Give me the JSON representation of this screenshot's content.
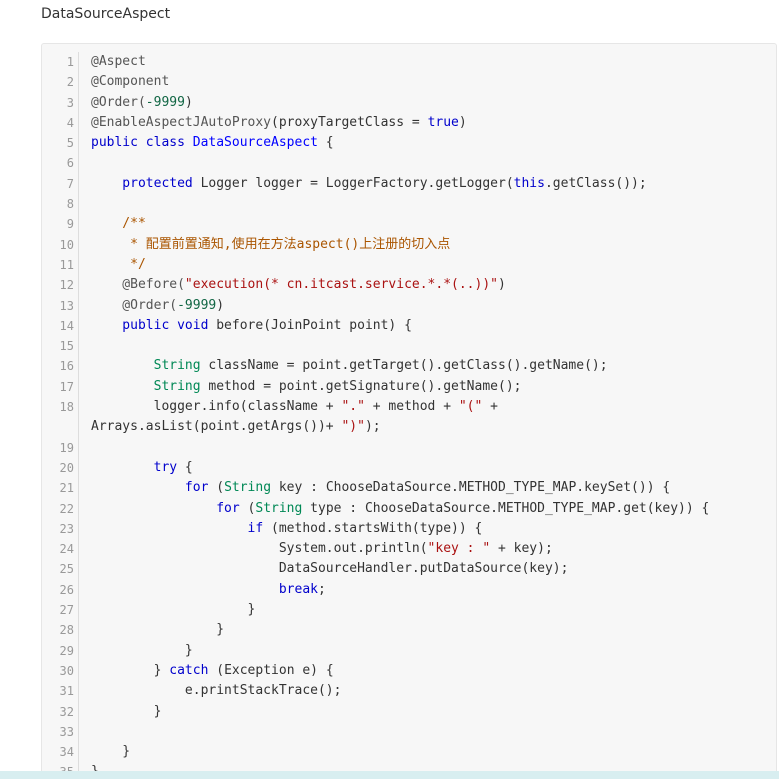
{
  "page": {
    "title": "DataSourceAspect"
  },
  "code": {
    "lines": [
      {
        "n": "1",
        "tokens": [
          {
            "t": "@Aspect",
            "c": "ann"
          }
        ]
      },
      {
        "n": "2",
        "tokens": [
          {
            "t": "@Component",
            "c": "ann"
          }
        ]
      },
      {
        "n": "3",
        "tokens": [
          {
            "t": "@Order(",
            "c": "ann"
          },
          {
            "t": "-9999",
            "c": "num"
          },
          {
            "t": ")",
            "c": ""
          }
        ]
      },
      {
        "n": "4",
        "tokens": [
          {
            "t": "@EnableAspectJAutoProxy",
            "c": "ann"
          },
          {
            "t": "(proxyTargetClass = ",
            "c": ""
          },
          {
            "t": "true",
            "c": "kw"
          },
          {
            "t": ")",
            "c": ""
          }
        ]
      },
      {
        "n": "5",
        "tokens": [
          {
            "t": "public class ",
            "c": "kw"
          },
          {
            "t": "DataSourceAspect",
            "c": "cls"
          },
          {
            "t": " {",
            "c": ""
          }
        ]
      },
      {
        "n": "6",
        "tokens": []
      },
      {
        "n": "7",
        "tokens": [
          {
            "t": "    protected ",
            "c": "kw"
          },
          {
            "t": "Logger logger = LoggerFactory.getLogger(",
            "c": ""
          },
          {
            "t": "this",
            "c": "kw"
          },
          {
            "t": ".getClass());",
            "c": ""
          }
        ]
      },
      {
        "n": "8",
        "tokens": []
      },
      {
        "n": "9",
        "tokens": [
          {
            "t": "    /**",
            "c": "cm"
          }
        ]
      },
      {
        "n": "10",
        "tokens": [
          {
            "t": "     * 配置前置通知,使用在方法aspect()上注册的切入点",
            "c": "cm"
          }
        ]
      },
      {
        "n": "11",
        "tokens": [
          {
            "t": "     */",
            "c": "cm"
          }
        ]
      },
      {
        "n": "12",
        "tokens": [
          {
            "t": "    @Before(",
            "c": "ann"
          },
          {
            "t": "\"execution(* cn.itcast.service.*.*(..))\"",
            "c": "str"
          },
          {
            "t": ")",
            "c": ""
          }
        ]
      },
      {
        "n": "13",
        "tokens": [
          {
            "t": "    @Order(",
            "c": "ann"
          },
          {
            "t": "-9999",
            "c": "num"
          },
          {
            "t": ")",
            "c": ""
          }
        ]
      },
      {
        "n": "14",
        "tokens": [
          {
            "t": "    public void ",
            "c": "kw"
          },
          {
            "t": "before(JoinPoint point) {",
            "c": ""
          }
        ]
      },
      {
        "n": "15",
        "tokens": []
      },
      {
        "n": "16",
        "tokens": [
          {
            "t": "        String ",
            "c": "type"
          },
          {
            "t": "className = point.getTarget().getClass().getName();",
            "c": ""
          }
        ]
      },
      {
        "n": "17",
        "tokens": [
          {
            "t": "        String ",
            "c": "type"
          },
          {
            "t": "method = point.getSignature().getName();",
            "c": ""
          }
        ]
      },
      {
        "n": "18",
        "tokens": [
          {
            "t": "        logger.info(className + ",
            "c": ""
          },
          {
            "t": "\".\"",
            "c": "str"
          },
          {
            "t": " + method + ",
            "c": ""
          },
          {
            "t": "\"(\"",
            "c": "str"
          },
          {
            "t": " +",
            "c": ""
          }
        ]
      },
      {
        "n": "",
        "tokens": [
          {
            "t": "Arrays.asList(point.getArgs())+ ",
            "c": ""
          },
          {
            "t": "\")\"",
            "c": "str"
          },
          {
            "t": ");",
            "c": ""
          }
        ]
      },
      {
        "n": "19",
        "tokens": []
      },
      {
        "n": "20",
        "tokens": [
          {
            "t": "        try",
            "c": "kw"
          },
          {
            "t": " {",
            "c": ""
          }
        ]
      },
      {
        "n": "21",
        "tokens": [
          {
            "t": "            for",
            "c": "kw"
          },
          {
            "t": " (",
            "c": ""
          },
          {
            "t": "String",
            "c": "type"
          },
          {
            "t": " key : ChooseDataSource.METHOD_TYPE_MAP.keySet()) {",
            "c": ""
          }
        ]
      },
      {
        "n": "22",
        "tokens": [
          {
            "t": "                for",
            "c": "kw"
          },
          {
            "t": " (",
            "c": ""
          },
          {
            "t": "String",
            "c": "type"
          },
          {
            "t": " type : ChooseDataSource.METHOD_TYPE_MAP.get(key)) {",
            "c": ""
          }
        ]
      },
      {
        "n": "23",
        "tokens": [
          {
            "t": "                    if",
            "c": "kw"
          },
          {
            "t": " (method.startsWith(type)) {",
            "c": ""
          }
        ]
      },
      {
        "n": "24",
        "tokens": [
          {
            "t": "                        System.out.println(",
            "c": ""
          },
          {
            "t": "\"key : \"",
            "c": "str"
          },
          {
            "t": " + key);",
            "c": ""
          }
        ]
      },
      {
        "n": "25",
        "tokens": [
          {
            "t": "                        DataSourceHandler.putDataSource(key);",
            "c": ""
          }
        ]
      },
      {
        "n": "26",
        "tokens": [
          {
            "t": "                        break",
            "c": "kw"
          },
          {
            "t": ";",
            "c": ""
          }
        ]
      },
      {
        "n": "27",
        "tokens": [
          {
            "t": "                    }",
            "c": ""
          }
        ]
      },
      {
        "n": "28",
        "tokens": [
          {
            "t": "                }",
            "c": ""
          }
        ]
      },
      {
        "n": "29",
        "tokens": [
          {
            "t": "            }",
            "c": ""
          }
        ]
      },
      {
        "n": "30",
        "tokens": [
          {
            "t": "        } ",
            "c": ""
          },
          {
            "t": "catch",
            "c": "kw"
          },
          {
            "t": " (Exception e) {",
            "c": ""
          }
        ]
      },
      {
        "n": "31",
        "tokens": [
          {
            "t": "            e.printStackTrace();",
            "c": ""
          }
        ]
      },
      {
        "n": "32",
        "tokens": [
          {
            "t": "        }",
            "c": ""
          }
        ]
      },
      {
        "n": "33",
        "tokens": []
      },
      {
        "n": "34",
        "tokens": [
          {
            "t": "    }",
            "c": ""
          }
        ]
      },
      {
        "n": "35",
        "tokens": [
          {
            "t": "}",
            "c": ""
          }
        ]
      }
    ]
  },
  "colors": {
    "keyword": "#0000cc",
    "type": "#008855",
    "string": "#aa1111",
    "number": "#116644",
    "comment": "#aa5500",
    "annotation": "#555555"
  }
}
